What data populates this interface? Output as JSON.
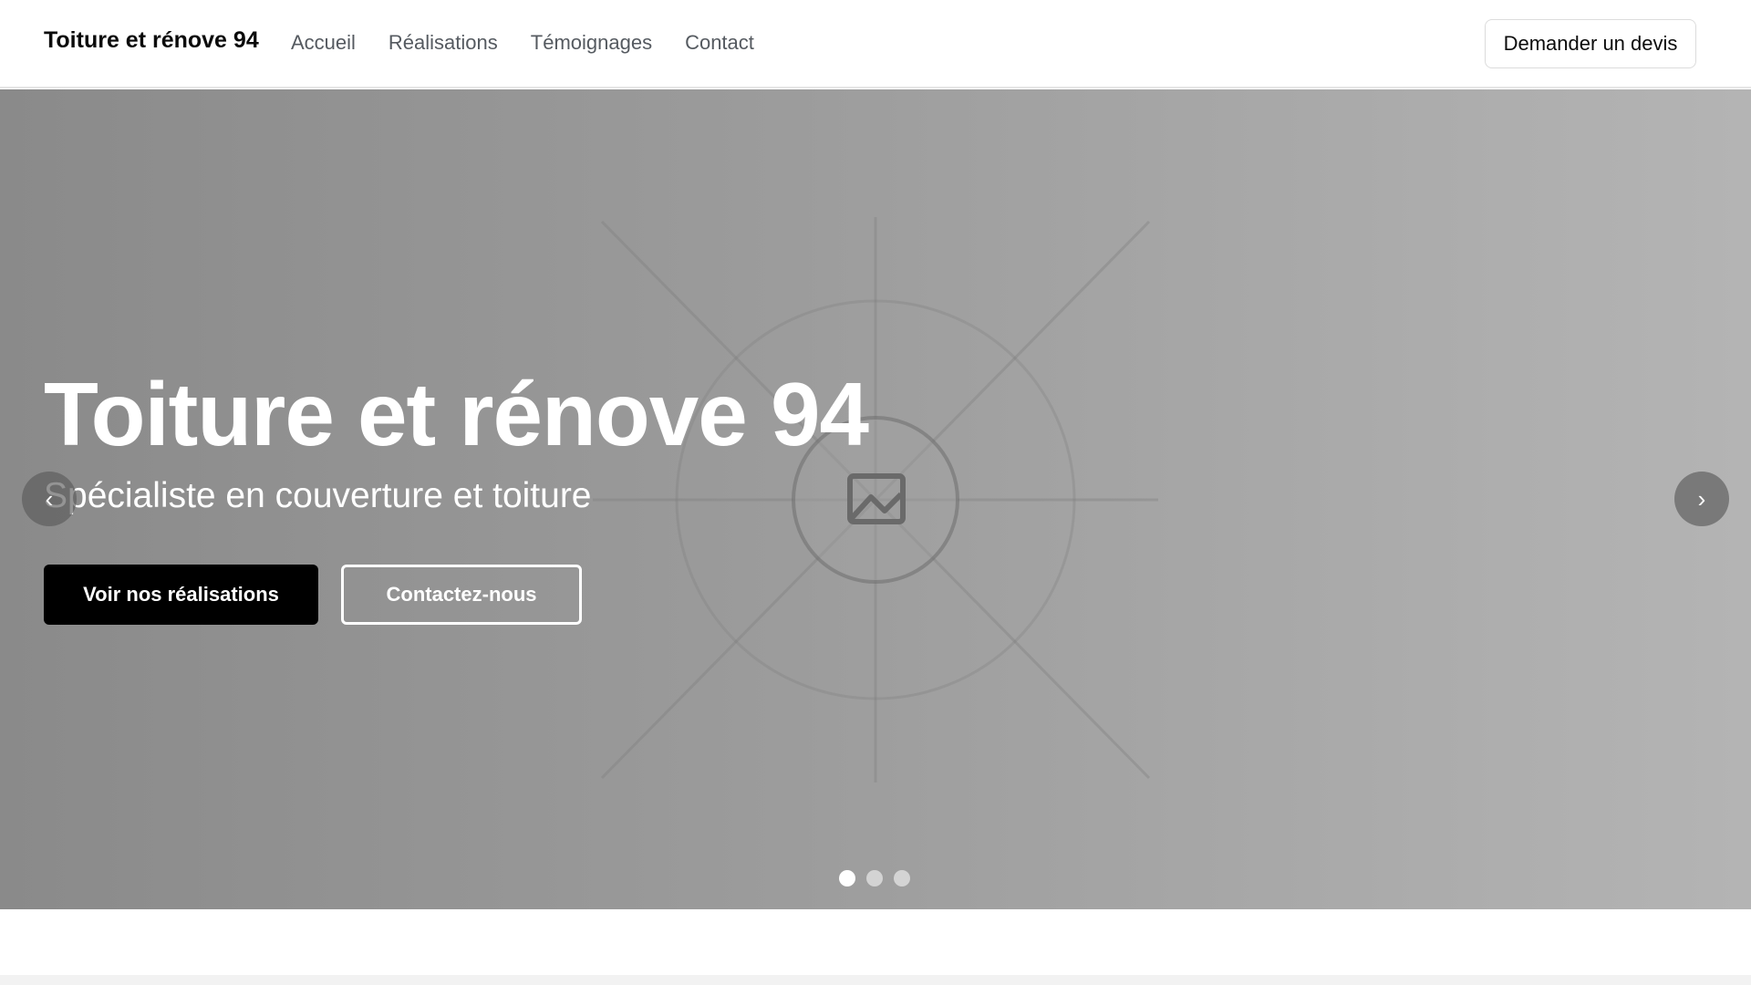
{
  "header": {
    "brand": "Toiture et rénove 94",
    "nav": [
      {
        "label": "Accueil"
      },
      {
        "label": "Réalisations"
      },
      {
        "label": "Témoignages"
      },
      {
        "label": "Contact"
      }
    ],
    "cta_label": "Demander un devis"
  },
  "hero": {
    "title": "Toiture et rénove 94",
    "subtitle": "Spécialiste en couverture et toiture",
    "primary_button": "Voir nos réalisations",
    "secondary_button": "Contactez-nous",
    "prev_icon": "chevron-left-icon",
    "next_icon": "chevron-right-icon",
    "image_placeholder_icon": "image-icon",
    "prev_glyph": "‹",
    "next_glyph": "›"
  },
  "carousel": {
    "slide_count": 3,
    "active_index": 0
  },
  "colors": {
    "primary_button_bg": "#000000",
    "hero_text": "#ffffff",
    "nav_text": "#555a60"
  }
}
